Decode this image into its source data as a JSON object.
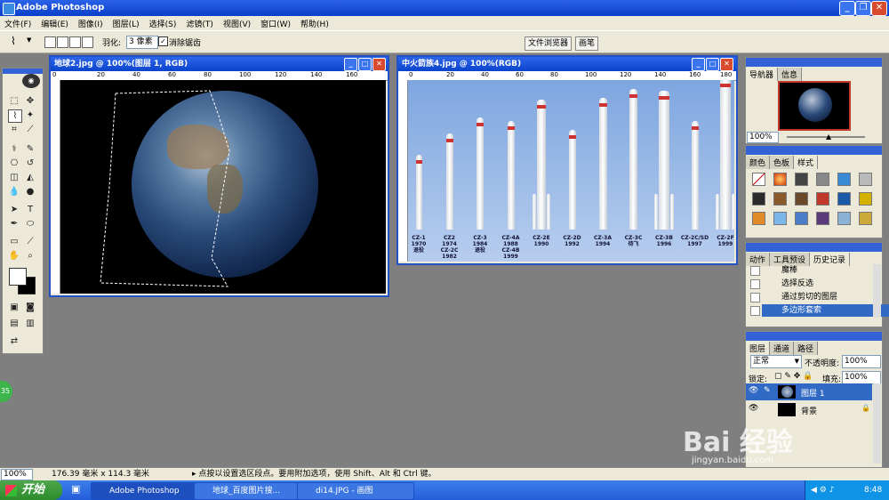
{
  "app": {
    "title": "Adobe Photoshop"
  },
  "menu": [
    "文件(F)",
    "编辑(E)",
    "图像(I)",
    "图层(L)",
    "选择(S)",
    "滤镜(T)",
    "视图(V)",
    "窗口(W)",
    "帮助(H)"
  ],
  "options": {
    "feather_label": "羽化:",
    "feather_value": "3 像素",
    "antialias_label": "消除锯齿",
    "antialias_checked": true
  },
  "top_tabs": [
    "文件浏览器",
    "画笔"
  ],
  "doc1": {
    "title": "地球2.jpg @ 100%(图层 1, RGB)",
    "ruler_ticks": [
      "0",
      "20",
      "40",
      "60",
      "80",
      "100",
      "120",
      "140",
      "160"
    ]
  },
  "doc2": {
    "title": "中火箭族4.jpg @ 100%(RGB)",
    "ruler_ticks": [
      "0",
      "20",
      "40",
      "60",
      "80",
      "100",
      "120",
      "140",
      "160",
      "180"
    ],
    "rockets": [
      {
        "l1": "CZ-1",
        "l2": "1970",
        "l3": "退役"
      },
      {
        "l1": "CZ2",
        "l2": "1974",
        "l3": "CZ-2C",
        "l4": "1982"
      },
      {
        "l1": "CZ-3",
        "l2": "1984",
        "l3": "退役"
      },
      {
        "l1": "CZ-4A",
        "l2": "1988",
        "l3": "CZ-4B",
        "l4": "1999"
      },
      {
        "l1": "CZ-2E",
        "l2": "1990"
      },
      {
        "l1": "CZ-2D",
        "l2": "1992"
      },
      {
        "l1": "CZ-3A",
        "l2": "1994"
      },
      {
        "l1": "CZ-3C",
        "l2": "待飞"
      },
      {
        "l1": "CZ-3B",
        "l2": "1996"
      },
      {
        "l1": "CZ-2C/SD",
        "l2": "1997"
      },
      {
        "l1": "CZ-2F",
        "l2": "1999"
      }
    ]
  },
  "navigator": {
    "tabs": [
      "导航器",
      "信息"
    ],
    "zoom": "100%"
  },
  "swatches": {
    "tabs": [
      "颜色",
      "色板",
      "样式"
    ]
  },
  "history": {
    "tabs": [
      "动作",
      "工具预设",
      "历史记录"
    ],
    "items": [
      "魔棒",
      "选择反选",
      "通过剪切的图层",
      "多边形套索"
    ],
    "selected_index": 3
  },
  "layers": {
    "tabs": [
      "图层",
      "通道",
      "路径"
    ],
    "blend_mode": "正常",
    "opacity_label": "不透明度:",
    "opacity": "100%",
    "lock_label": "锁定:",
    "fill_label": "填充:",
    "fill": "100%",
    "items": [
      {
        "name": "图层 1"
      },
      {
        "name": "背景"
      }
    ]
  },
  "status": {
    "zoom": "100%",
    "doc_size": "176.39 毫米 x 114.3 毫米",
    "hint": "▸ 点按以设置选区段点。要用附加选项，使用 Shift、Alt 和 Ctrl 键。"
  },
  "taskbar": {
    "start": "开始",
    "tasks": [
      "Adobe Photoshop",
      "地球_百度图片搜...",
      "di14.JPG - 画图"
    ],
    "clock": "8:48"
  },
  "watermark": {
    "text": "Bai 经验",
    "url": "jingyan.baidu.com"
  },
  "badge": "35"
}
